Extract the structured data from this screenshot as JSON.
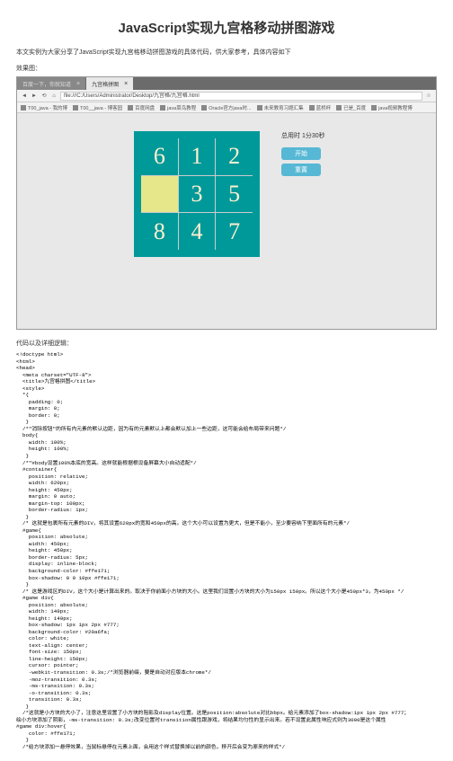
{
  "title": "JavaScript实现九宫格移动拼图游戏",
  "intro": "本文实例为大家分享了JavaScript实现九宫格移动拼图游戏的具体代码，供大家参考，具体内容如下",
  "label_effect": "效果图：",
  "browser": {
    "tab1": "百度一下，你就知道",
    "tab2": "九宫格拼图",
    "url": "file:///C:/Users/Administrator/Desktop/九宫格/九宫格.html",
    "bk1": "T00_java - 我的博",
    "bk2": "T00__java - 博客园",
    "bk3": "百度网盘",
    "bk4": "java菜鸟教程",
    "bk5": "Oracle官方java时...",
    "bk6": "未来教育习题汇集",
    "bk7": "蓝桥杯",
    "bk8": "已是_百度",
    "bk9": "java视频教程博"
  },
  "game": {
    "tiles": [
      "6",
      "1",
      "2",
      "",
      "3",
      "5",
      "8",
      "4",
      "7"
    ],
    "timer": "总用时 1分30秒",
    "btn_start": "开始",
    "btn_reset": "重置"
  },
  "label_code": "代码以及详细逻辑：",
  "code": "<!doctype html>\n<html>\n<head>\n  <meta charset=\"UTF-8\">\n  <title>九宫格拼图</title>\n  <style>\n  *{\n    padding: 0;\n    margin: 0;\n    border: 0;\n   }\n  /*\"消除按钮\"的所有内元素的默认边距，因为有的元素默认上都会默认加上一些边距，这可能会给布局带来问题*/\n  body{\n    width: 100%;\n    height: 100%;\n   }\n  /*\"#body设置100%本底的宽高。这样就能根据根设备屏幕大小自动适配*/\n  #container{\n    position: relative;\n    width: 620px;\n    height: 450px;\n    margin: 0 auto;\n    margin-top: 100px;\n    border-radius: 1px;\n   }\n  /* 这就是包裹所有元素的DIV，将其设置620px的宽和450px的高。这个大小可以设置为更大，但是不能小，至少要容纳下里面所有的元素*/\n  #game{\n    position: absolute;\n    width: 450px;\n    height: 450px;\n    border-radius: 5px;\n    display: inline-block;\n    background-color: #ffe171;\n    box-shadow: 0 0 10px #ffe171;\n   }\n  /* 这是游戏区的DIV，这个大小是计算出来的。取决于你前面小方块的大小。这里我们设置小方块的大小为150px 150px。所以这个大小是450px*3，为450px */\n  #game div{\n    position: absolute;\n    width: 149px;\n    height: 149px;\n    box-shadow: 1px 1px 2px #777;\n    background-color: #20a6fa;\n    color: white;\n    text-align: center;\n    font-size: 150px;\n    line-height: 150px;\n    cursor: pointer;\n    -webkit-transition: 0.3s;/*浏览器前缀，要是自动对应版本chrome*/\n    -moz-transition: 0.3s;\n    -ms-transition: 0.3s;\n    -o-transition: 0.3s;\n    transition: 0.3s;\n   }\n  /*这就是小方块的大小了，注意这里设置了小方块的阻影及display位置。这是position:absolute对比bbpx。给元素添加了box-shadow:1px 1px 2px #777；\n绘小方块添加了阴影，-ms-transition: 0.3s;改变位置时transition属性跟游戏，将结果均匀性的显示出来。若不设置此属性响应式则为3000是这个属性\n#game div:hover{\n    color: #ffe171;\n   }\n  /*给方块添加一悬停效果，当鼠标悬停在元素上面，会用这个样式替换掉以前的颜色，移开后会变为原来的样式*/"
}
